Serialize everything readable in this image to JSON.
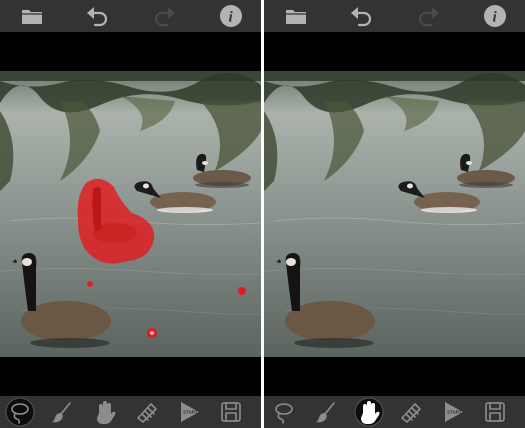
{
  "screens": [
    {
      "id": "left",
      "toolbar": [
        {
          "icon": "folder-icon",
          "enabled": true
        },
        {
          "icon": "undo-icon",
          "enabled": true
        },
        {
          "icon": "redo-icon",
          "enabled": false
        },
        {
          "icon": "info-icon",
          "enabled": true,
          "label": "i"
        }
      ],
      "tools": [
        {
          "icon": "lasso-icon",
          "selected": true
        },
        {
          "icon": "brush-icon",
          "selected": false
        },
        {
          "icon": "hand-icon",
          "selected": false
        },
        {
          "icon": "eraser-icon",
          "selected": false
        },
        {
          "icon": "start-icon",
          "selected": false,
          "label": "START"
        },
        {
          "icon": "save-icon",
          "selected": false
        }
      ],
      "mask_color": "#e8141a"
    },
    {
      "id": "right",
      "toolbar": [
        {
          "icon": "folder-icon",
          "enabled": true
        },
        {
          "icon": "undo-icon",
          "enabled": true
        },
        {
          "icon": "redo-icon",
          "enabled": false
        },
        {
          "icon": "info-icon",
          "enabled": true,
          "label": "i"
        }
      ],
      "tools": [
        {
          "icon": "lasso-icon",
          "selected": false
        },
        {
          "icon": "brush-icon",
          "selected": false
        },
        {
          "icon": "hand-icon",
          "selected": true
        },
        {
          "icon": "eraser-icon",
          "selected": false
        },
        {
          "icon": "start-icon",
          "selected": false,
          "label": "START"
        },
        {
          "icon": "save-icon",
          "selected": false
        }
      ]
    }
  ],
  "colors": {
    "bar": "#333333",
    "icon": "#b3b3b3",
    "icon_disabled": "#4a4a4a",
    "tool_icon": "#8c8c8c",
    "water": "#8e9790",
    "trees": "#3f4a32"
  }
}
